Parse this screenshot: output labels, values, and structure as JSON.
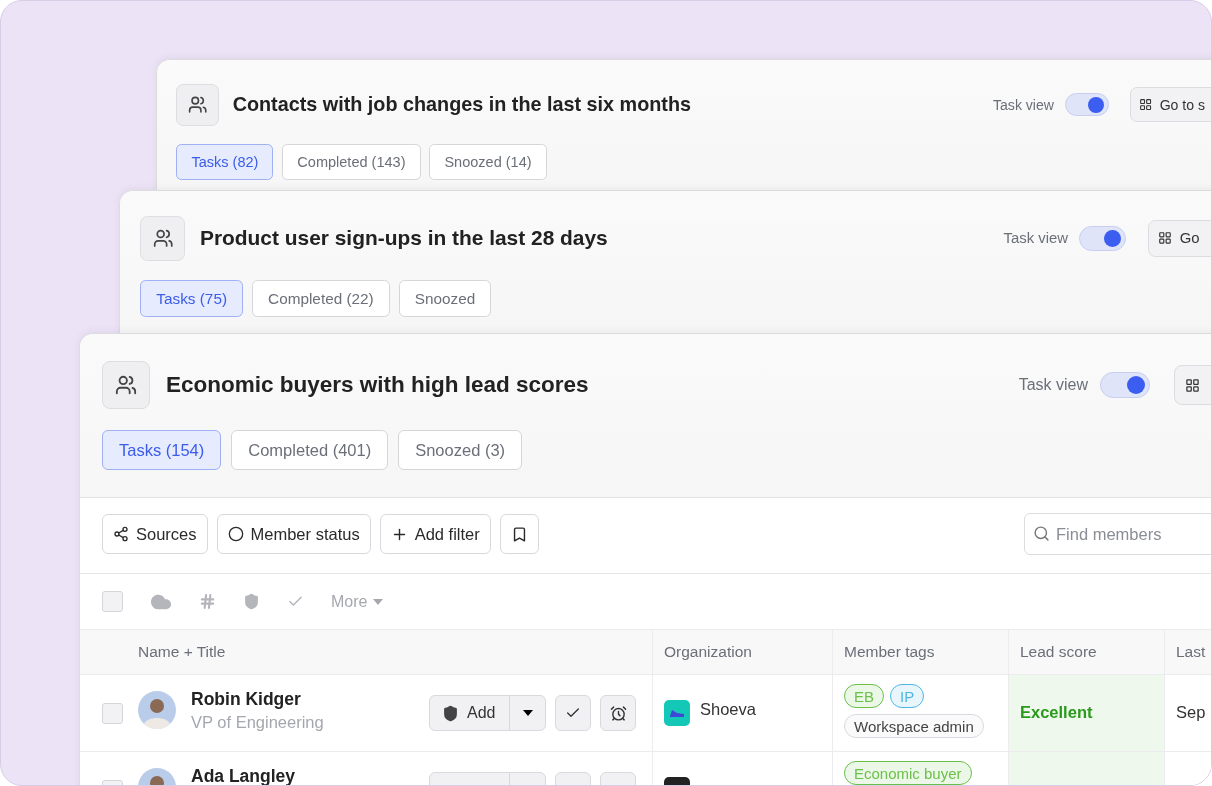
{
  "cards": [
    {
      "title": "Contacts with job changes in the last six months",
      "toggle": {
        "label": "Task view",
        "on": true
      },
      "goto_label": "Go to s",
      "tabs": [
        {
          "label": "Tasks (82)",
          "selected": true
        },
        {
          "label": "Completed (143)",
          "selected": false
        },
        {
          "label": "Snoozed (14)",
          "selected": false
        }
      ]
    },
    {
      "title": "Product user sign-ups in the last 28 days",
      "toggle": {
        "label": "Task view",
        "on": true
      },
      "goto_label": "Go",
      "tabs": [
        {
          "label": "Tasks (75)",
          "selected": true
        },
        {
          "label": "Completed (22)",
          "selected": false
        },
        {
          "label": "Snoozed",
          "selected": false
        }
      ]
    },
    {
      "title": "Economic buyers with high lead scores",
      "toggle": {
        "label": "Task view",
        "on": true
      },
      "tabs": [
        {
          "label": "Tasks (154)",
          "selected": true
        },
        {
          "label": "Completed (401)",
          "selected": false
        },
        {
          "label": "Snoozed (3)",
          "selected": false
        }
      ]
    }
  ],
  "filters": [
    {
      "kind": "sources",
      "label": "Sources"
    },
    {
      "kind": "status",
      "label": "Member status"
    },
    {
      "kind": "add",
      "label": "Add filter"
    },
    {
      "kind": "bookmark"
    }
  ],
  "search": {
    "placeholder": "Find members"
  },
  "bulk": {
    "checked": false,
    "more_label": "More"
  },
  "table": {
    "columns": [
      "Name + Title",
      "Organization",
      "Member tags",
      "Lead score",
      "Last"
    ],
    "rows": [
      {
        "checked": false,
        "name": "Robin Kidger",
        "title": "VP of Engineering",
        "action_label": "Add",
        "organization": {
          "name": "Shoeva",
          "color": "#14c8b8"
        },
        "tags": [
          {
            "label": "EB",
            "color": "#6cc04a"
          },
          {
            "label": "IP",
            "color": "#4fb7e4"
          },
          {
            "label": "Workspace admin",
            "color": "#d8dadf"
          }
        ],
        "lead_score": "Excellent",
        "last": "Sep"
      },
      {
        "checked": false,
        "name": "Ada Langley",
        "organization": {
          "color": "#222222"
        },
        "tags": [
          {
            "label": "Economic buyer",
            "color": "#6cc04a"
          }
        ]
      }
    ]
  }
}
